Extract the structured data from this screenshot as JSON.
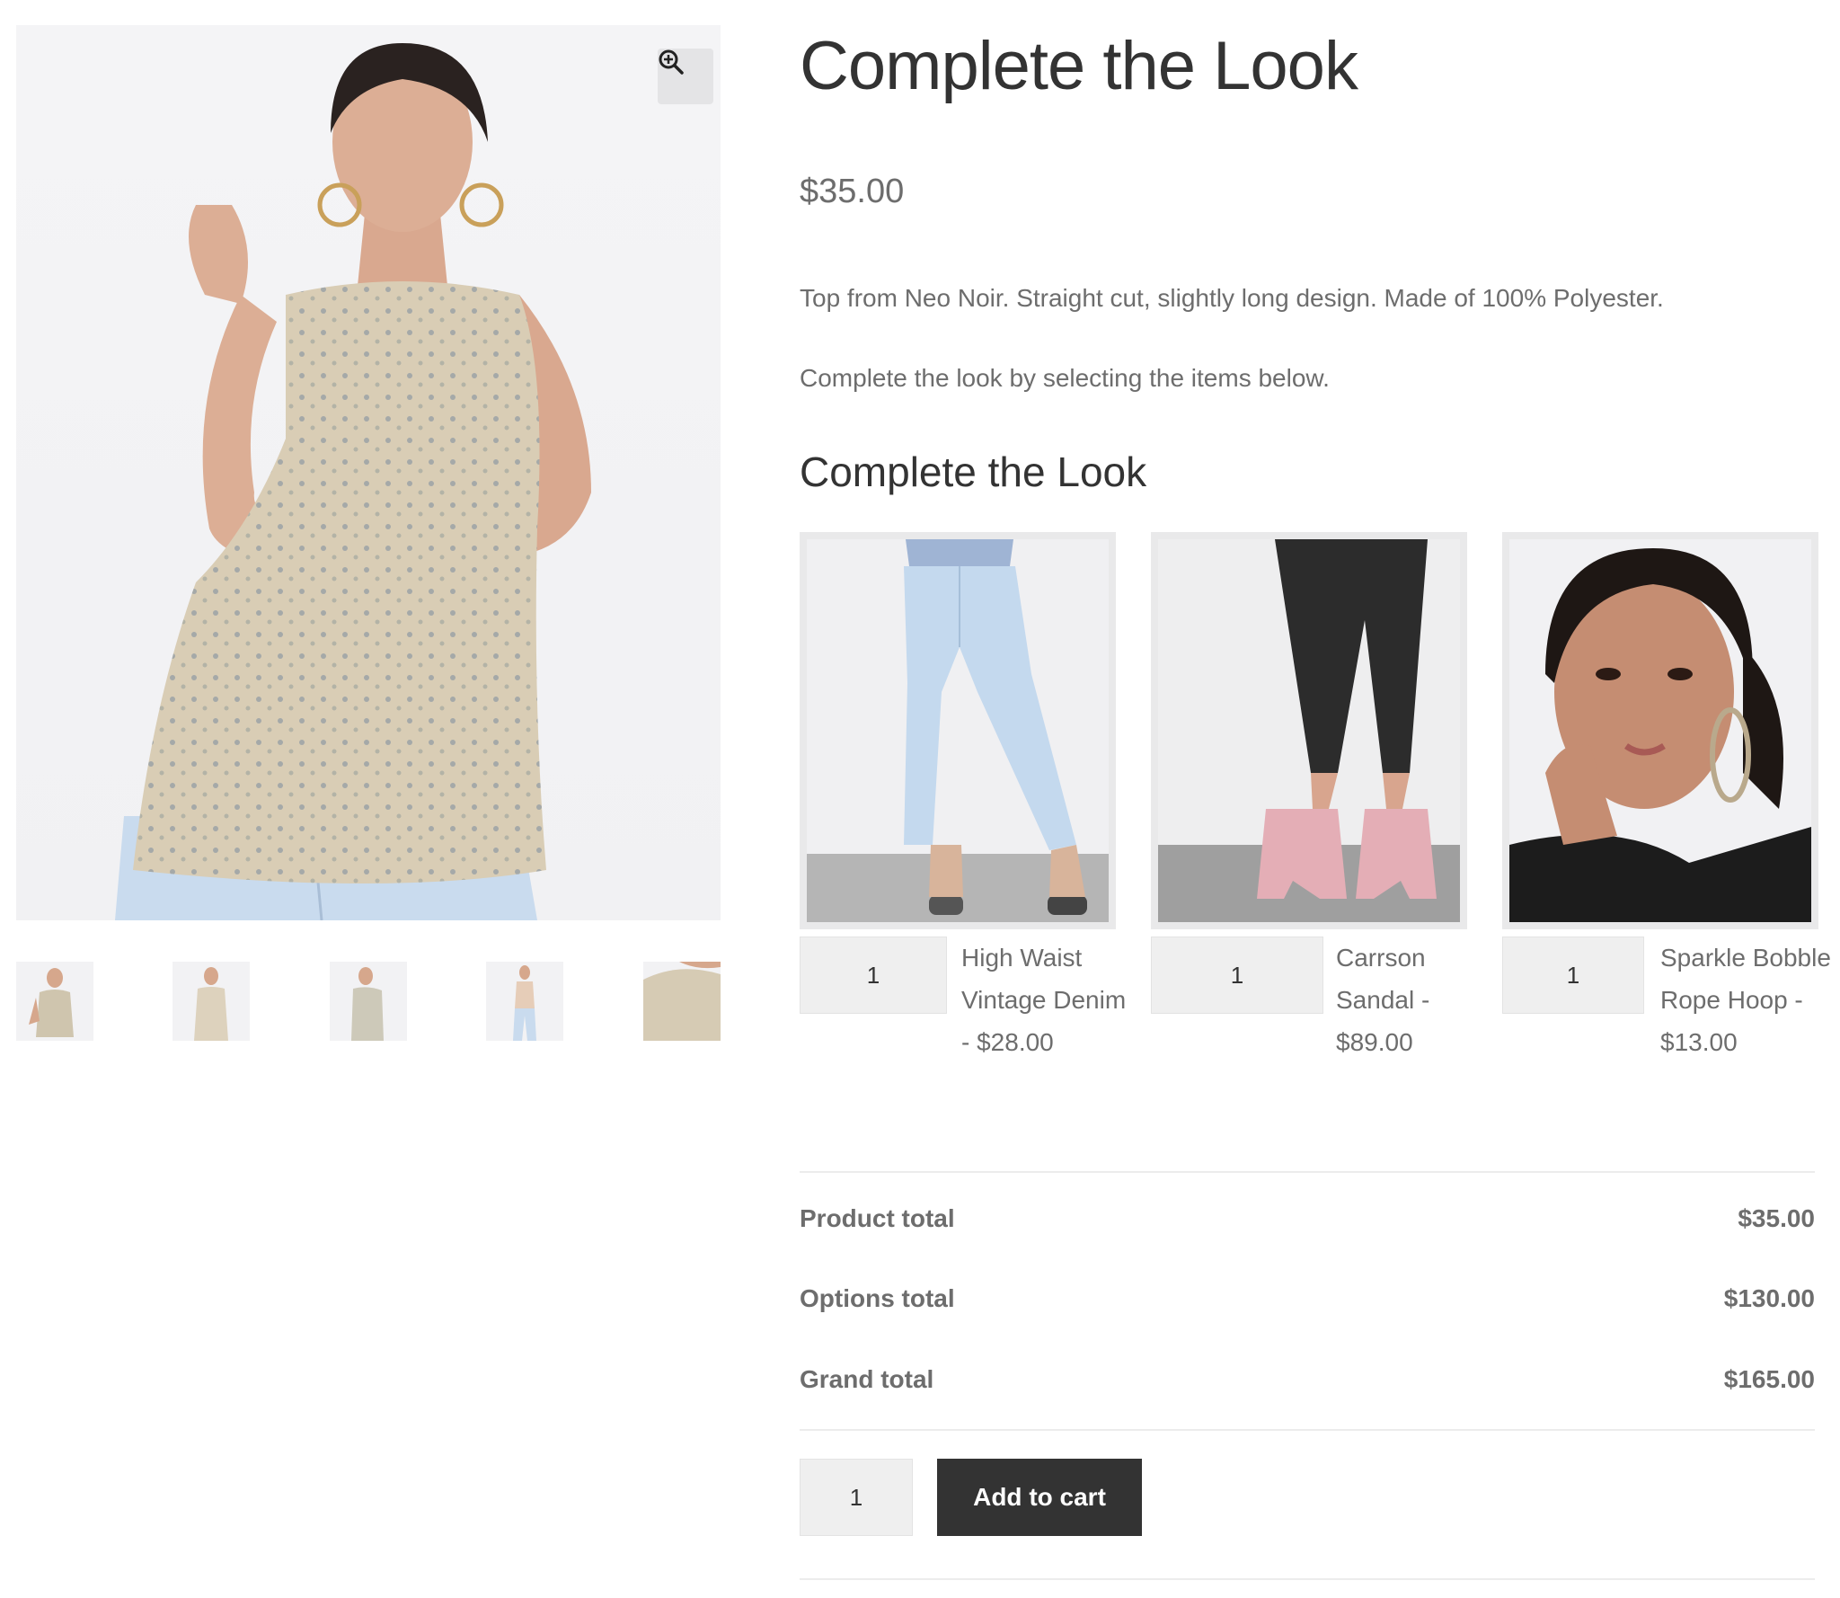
{
  "product": {
    "title": "Complete the Look",
    "price": "$35.00",
    "description": "Top from Neo Noir. Straight cut, slightly long design. Made of 100% Polyester.",
    "instructions": "Complete the look by selecting the items below."
  },
  "gallery": {
    "zoom_icon": "zoom-in-icon",
    "thumbnail_count": 5
  },
  "options": {
    "heading": "Complete the Look",
    "items": [
      {
        "label": "High Waist Vintage Denim - $28.00",
        "qty": "1"
      },
      {
        "label": "Carrson Sandal - $89.00",
        "qty": "1"
      },
      {
        "label": "Sparkle Bobble Rope Hoop - $13.00",
        "qty": "1"
      }
    ]
  },
  "totals": {
    "product_label": "Product total",
    "product_value": "$35.00",
    "options_label": "Options total",
    "options_value": "$130.00",
    "grand_label": "Grand total",
    "grand_value": "$165.00"
  },
  "cart": {
    "qty": "1",
    "button_label": "Add to cart"
  },
  "colors": {
    "heading": "#333333",
    "body_text": "#6d6d6d",
    "button_bg": "#333333",
    "input_bg": "#efefef"
  }
}
